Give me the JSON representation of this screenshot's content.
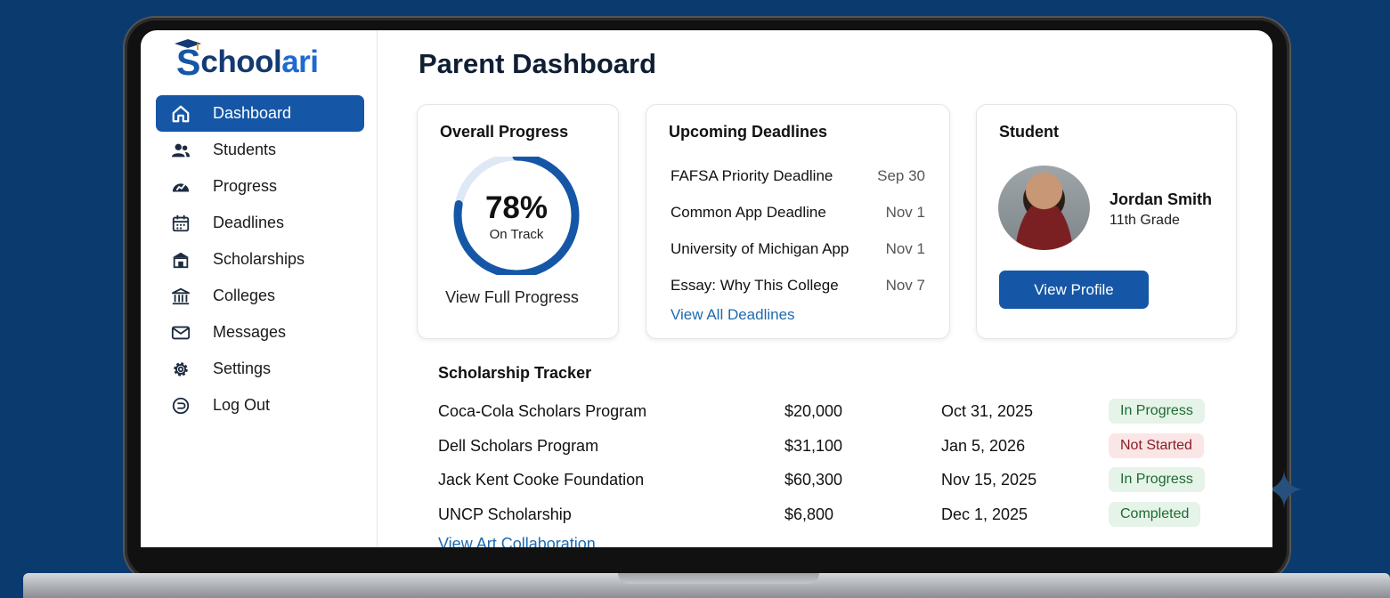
{
  "app": {
    "logo_initial": "S",
    "logo_text_main": "chool",
    "logo_text_accent": "ari"
  },
  "sidebar": {
    "items": [
      {
        "label": "Dashboard",
        "icon": "home-icon",
        "active": true
      },
      {
        "label": "Students",
        "icon": "users-icon"
      },
      {
        "label": "Progress",
        "icon": "gauge-icon"
      },
      {
        "label": "Deadlines",
        "icon": "calendar-icon"
      },
      {
        "label": "Scholarships",
        "icon": "school-icon"
      },
      {
        "label": "Colleges",
        "icon": "bank-icon"
      },
      {
        "label": "Messages",
        "icon": "mail-icon"
      },
      {
        "label": "Settings",
        "icon": "gear-icon"
      },
      {
        "label": "Log Out",
        "icon": "logout-icon"
      }
    ]
  },
  "page": {
    "title": "Parent Dashboard"
  },
  "progress": {
    "title": "Overall Progress",
    "percent_label": "78%",
    "percent": 78,
    "status": "On Track",
    "link": "View Full Progress"
  },
  "deadlines": {
    "title": "Upcoming Deadlines",
    "items": [
      {
        "name": "FAFSA Priority Deadline",
        "date": "Sep 30"
      },
      {
        "name": "Common App Deadline",
        "date": "Nov 1"
      },
      {
        "name": "University of Michigan App",
        "date": "Nov 1"
      },
      {
        "name": "Essay: Why This College",
        "date": "Nov 7"
      }
    ],
    "link": "View All Deadlines"
  },
  "student": {
    "title": "Student",
    "name": "Jordan Smith",
    "grade": "11th Grade",
    "button": "View Profile"
  },
  "tracker": {
    "title": "Scholarship Tracker",
    "rows": [
      {
        "name": "Coca-Cola Scholars Program",
        "amount": "$20,000",
        "date": "Oct 31, 2025",
        "status": "In Progress"
      },
      {
        "name": "Dell Scholars Program",
        "amount": "$31,100",
        "date": "Jan 5, 2026",
        "status": "Not Started"
      },
      {
        "name": "Jack Kent Cooke Foundation",
        "amount": "$60,300",
        "date": "Nov 15, 2025",
        "status": "In Progress"
      },
      {
        "name": "UNCP Scholarship",
        "amount": "$6,800",
        "date": "Dec 1, 2025",
        "status": "Completed"
      }
    ],
    "link": "View Art Collaboration"
  },
  "colors": {
    "primary": "#1557a6",
    "background": "#0b3a6e",
    "link": "#1e6ab0",
    "ring_track": "#dfe8f5"
  }
}
